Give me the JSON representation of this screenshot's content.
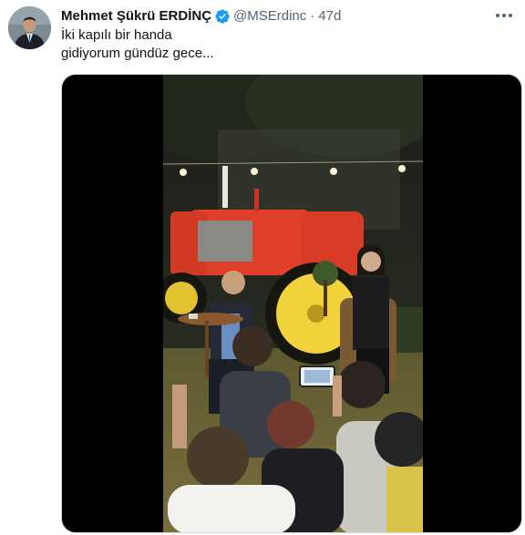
{
  "tweet": {
    "author_name": "Mehmet Şükrü ERDİNÇ",
    "handle": "@MSErdinc",
    "separator": "·",
    "time": "47d",
    "text_lines": [
      "İki kapılı bir handa",
      "gidiyorum gündüz gece..."
    ]
  },
  "icons": {
    "verified": "verified-badge-icon",
    "more": "more-options-icon",
    "avatar": "profile-photo"
  },
  "colors": {
    "verified": "#1d9bf0",
    "secondary_text": "#536471",
    "primary_text": "#0f1419",
    "media_background": "#000000",
    "tractor": "#e0402a",
    "wheel_rim": "#f2d23a"
  }
}
